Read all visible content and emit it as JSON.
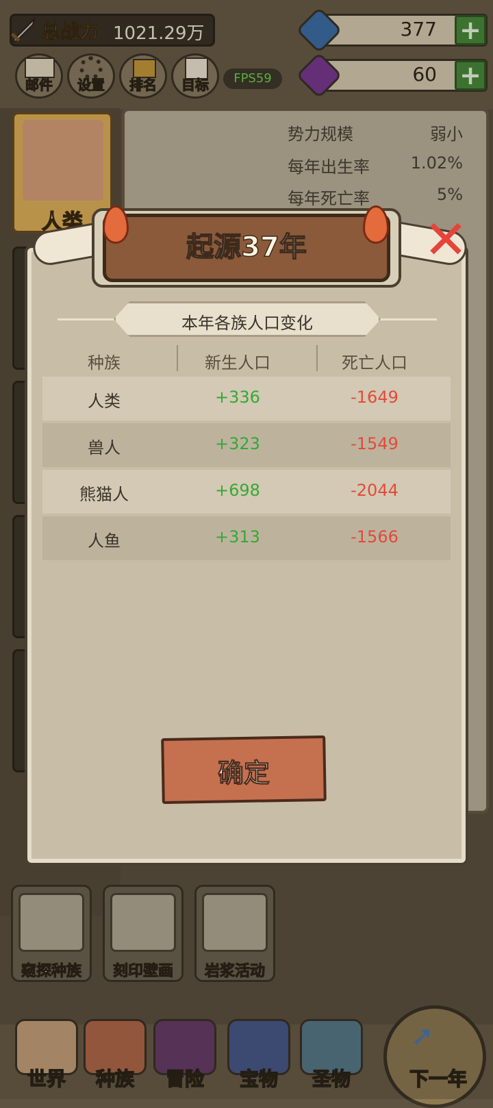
{
  "hud": {
    "power_label": "总战力",
    "power_value": "1021.29万",
    "gems_value": "377",
    "crystals_value": "60",
    "plus": "+",
    "fps": "FPS59",
    "menu": [
      "邮件",
      "设置",
      "排名",
      "目标"
    ]
  },
  "faction_panel": {
    "race_name": "人类",
    "stats": [
      {
        "label": "势力规模",
        "value": "弱小"
      },
      {
        "label": "每年出生率",
        "value": "1.02%"
      },
      {
        "label": "每年死亡率",
        "value": "5%"
      }
    ]
  },
  "dialog": {
    "title": "起源37年",
    "subtitle": "本年各族人口变化",
    "columns": [
      "种族",
      "新生人口",
      "死亡人口"
    ],
    "rows": [
      {
        "race": "人类",
        "born": "+336",
        "died": "-1649"
      },
      {
        "race": "兽人",
        "born": "+323",
        "died": "-1549"
      },
      {
        "race": "熊猫人",
        "born": "+698",
        "died": "-2044"
      },
      {
        "race": "人鱼",
        "born": "+313",
        "died": "-1566"
      }
    ],
    "confirm": "确定",
    "close_glyph": "✕"
  },
  "actions": [
    "窥探种族",
    "刻印壁画",
    "岩浆活动"
  ],
  "bottom_nav": [
    "世界",
    "种族",
    "冒险",
    "宝物",
    "圣物",
    "下一年"
  ],
  "colors": {
    "born": "#36a836",
    "died": "#e24a3a",
    "fps": "#6fd44f",
    "power_label": "#f2b338"
  }
}
